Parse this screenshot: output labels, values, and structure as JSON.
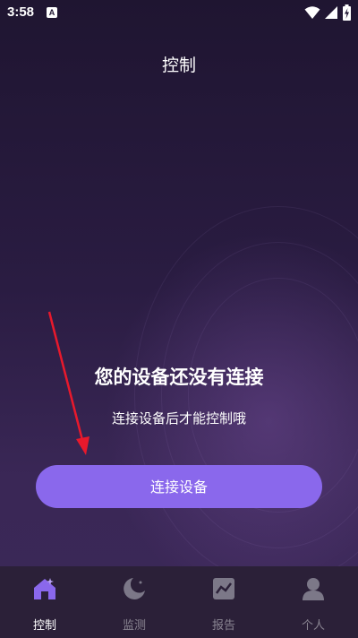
{
  "status_bar": {
    "time": "3:58",
    "notification_letter": "A"
  },
  "header": {
    "title": "控制"
  },
  "empty_state": {
    "headline": "您的设备还没有连接",
    "subtitle": "连接设备后才能控制哦",
    "button_label": "连接设备"
  },
  "colors": {
    "accent": "#8a68ec",
    "annotation_arrow": "#e8192c",
    "tab_active": "#8a68ec",
    "tab_inactive": "#7c7888"
  },
  "tabs": [
    {
      "label": "控制",
      "icon": "home-icon",
      "active": true
    },
    {
      "label": "监测",
      "icon": "moon-icon",
      "active": false
    },
    {
      "label": "报告",
      "icon": "report-chart-icon",
      "active": false
    },
    {
      "label": "个人",
      "icon": "person-icon",
      "active": false
    }
  ]
}
